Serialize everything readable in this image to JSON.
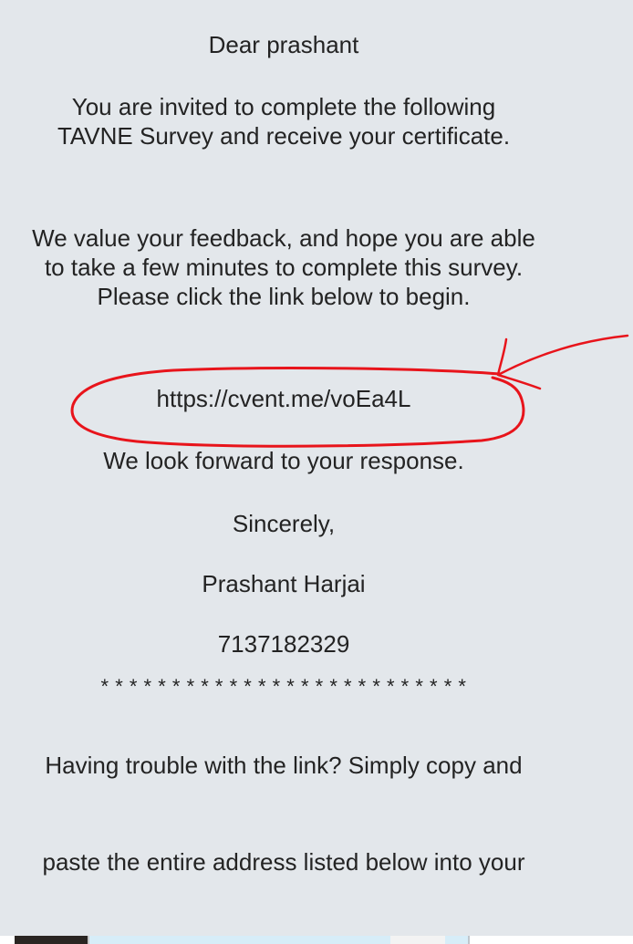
{
  "email": {
    "greeting": "Dear prashant",
    "invite": "You are invited to complete the following TAVNE Survey and receive your certificate.",
    "value": "We value your feedback, and hope you are able to take a few minutes to complete this survey. Please click the link below to begin.",
    "survey_link": "https://cvent.me/voEa4L",
    "forward": "We look forward to your response.",
    "sincerely": "Sincerely,",
    "sender_name": "Prashant Harjai",
    "sender_phone": "7137182329",
    "separator": "* * * * * * * * * * * * * * * * * * * * * * * * * *",
    "trouble_line1": "Having trouble with the link? Simply copy and",
    "trouble_line2": "paste the entire address listed below into your"
  },
  "colors": {
    "panel_background": "#e3e7eb",
    "text": "#232323",
    "annotation": "#e8141b"
  },
  "icons": {
    "annotation_arrow": "red-hand-drawn-arrow",
    "annotation_circle": "red-hand-drawn-ellipse"
  }
}
